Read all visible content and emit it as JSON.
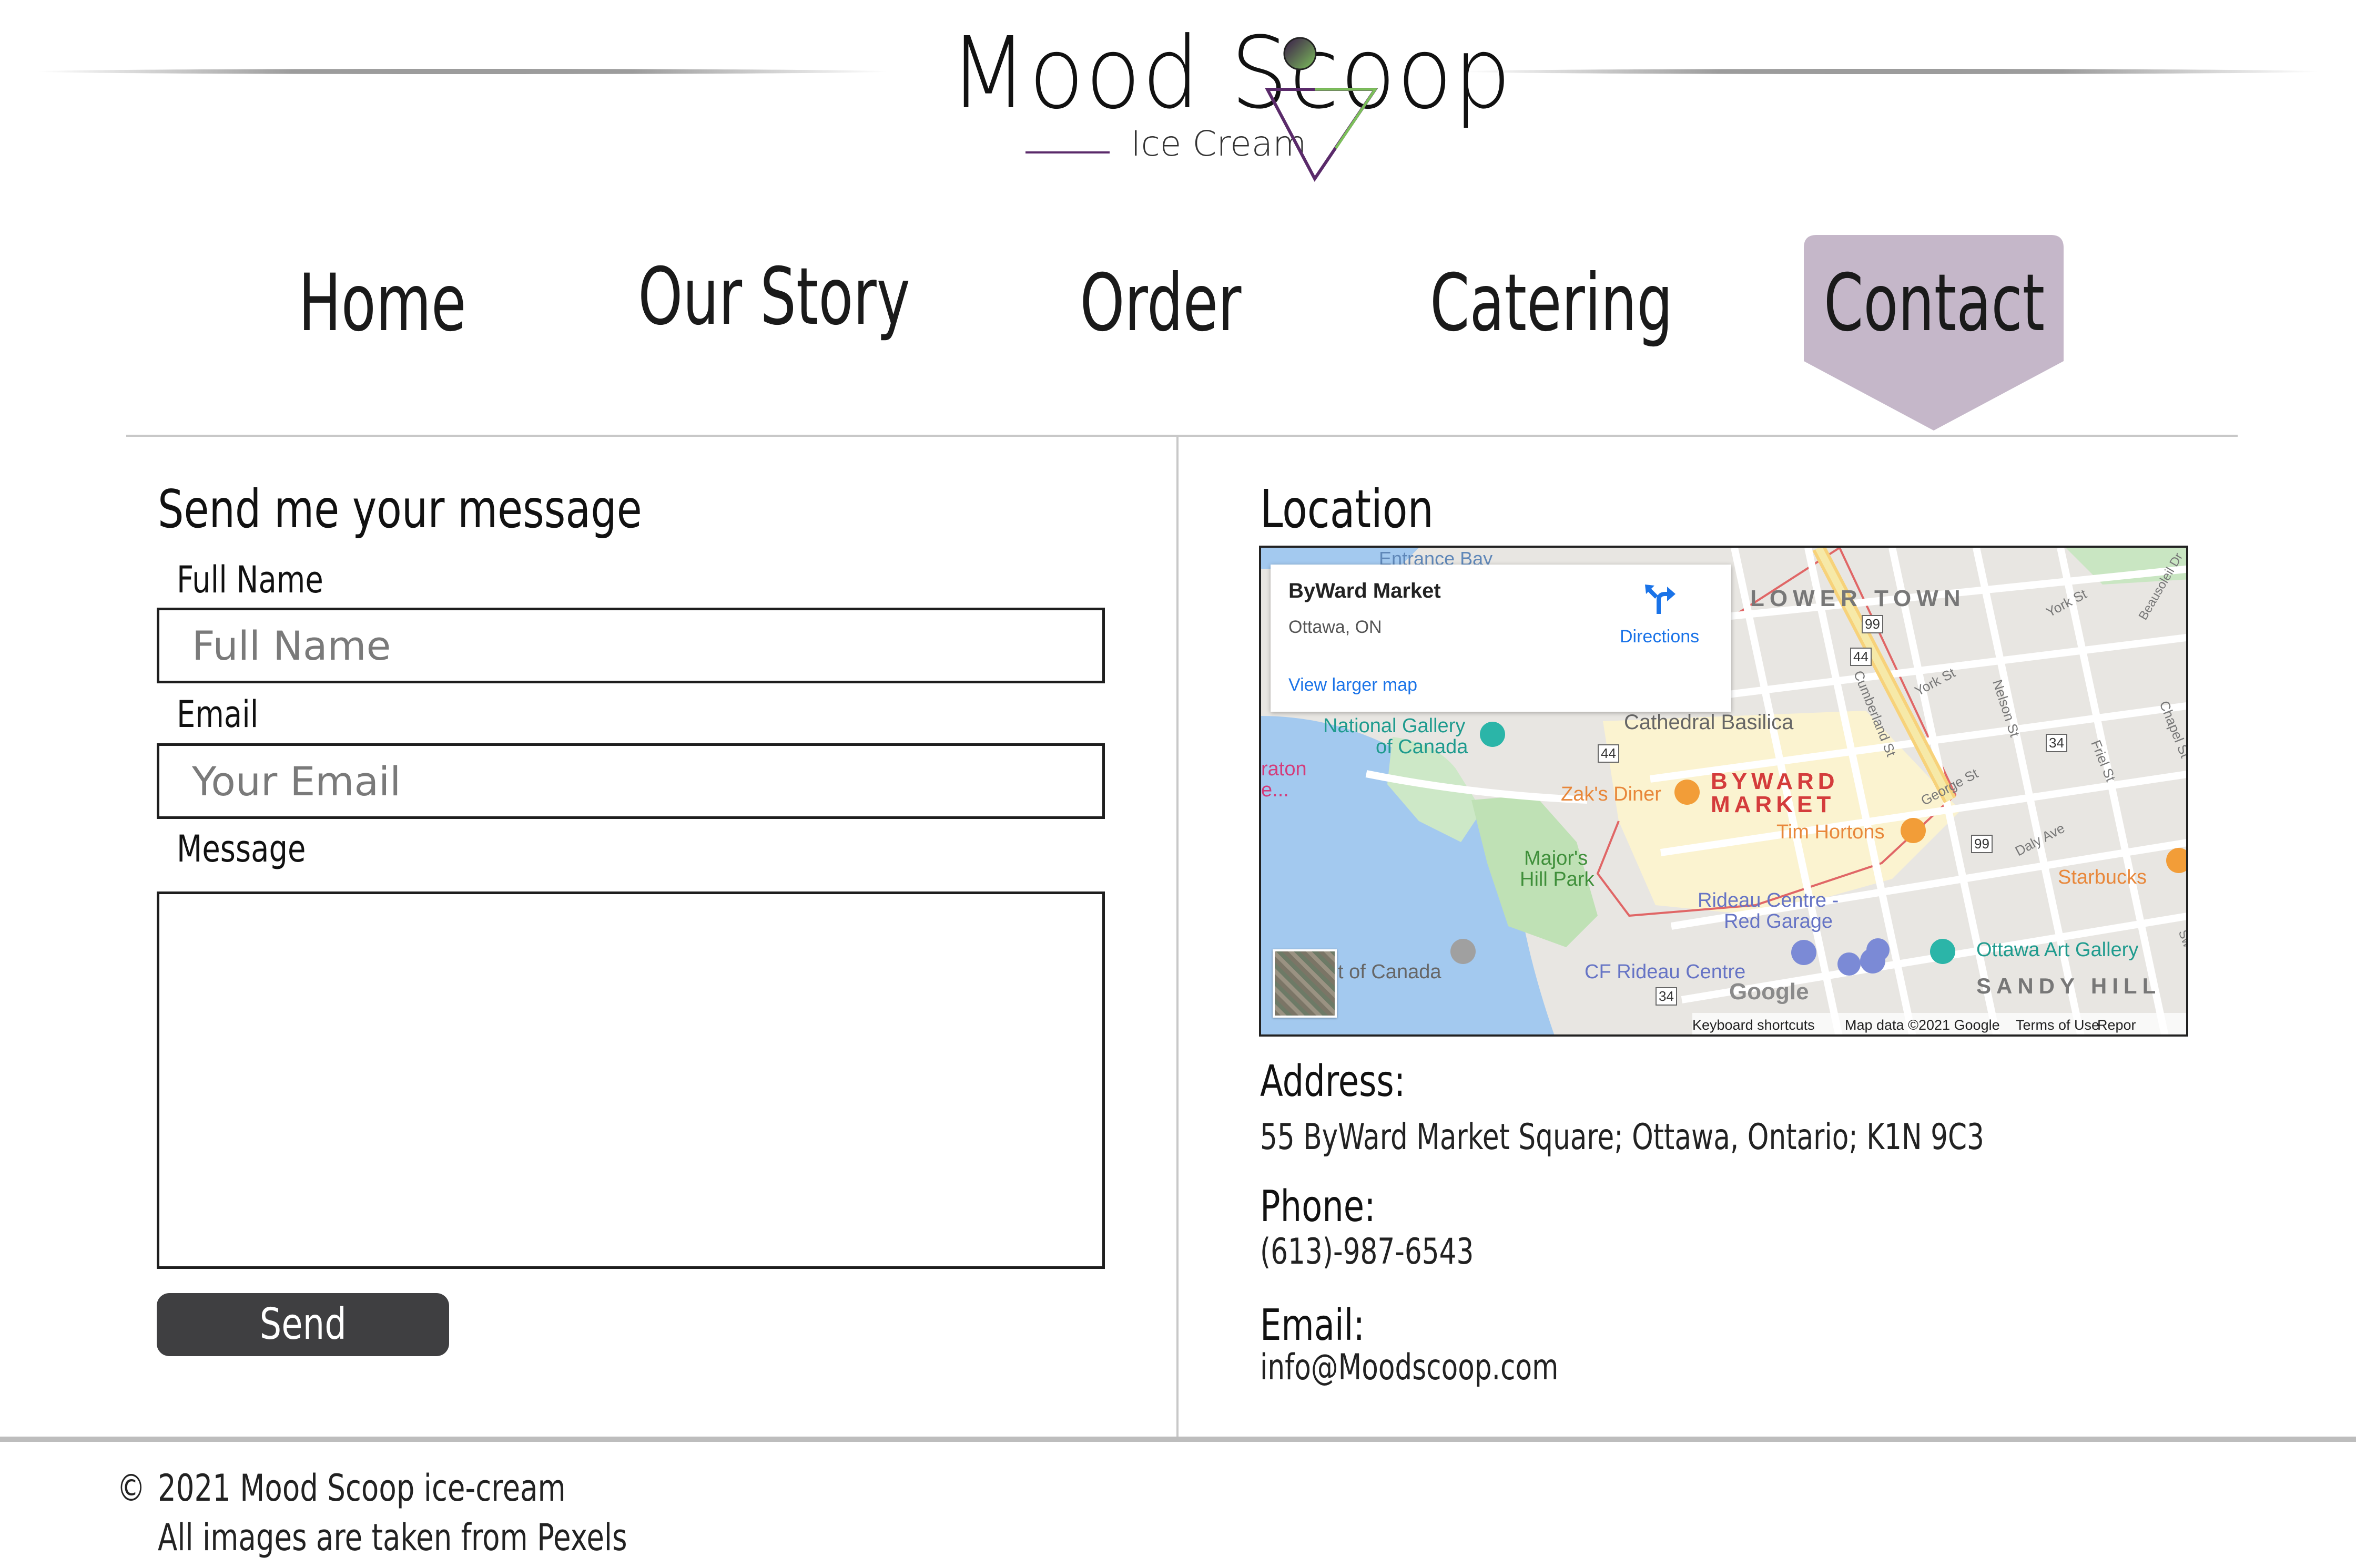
{
  "brand": {
    "name": "Mood Scoop",
    "tagline": "Ice Cream"
  },
  "nav": {
    "items": [
      {
        "label": "Home"
      },
      {
        "label": "Our Story"
      },
      {
        "label": "Order"
      },
      {
        "label": "Catering"
      },
      {
        "label": "Contact",
        "active": true
      }
    ],
    "active_color": "#c5b7c9"
  },
  "form": {
    "title": "Send me your message",
    "full_name": {
      "label": "Full Name",
      "placeholder": "Full Name",
      "value": ""
    },
    "email": {
      "label": "Email",
      "placeholder": "Your Email",
      "value": ""
    },
    "message": {
      "label": "Message",
      "value": ""
    },
    "send_label": "Send"
  },
  "location": {
    "title": "Location",
    "map": {
      "place": "ByWard Market",
      "city": "Ottawa, ON",
      "directions": "Directions",
      "larger_map": "View larger map",
      "labels": {
        "entrance_bay": "Entrance Bay",
        "lower_town": "LOWER TOWN",
        "national_gallery": "National Gallery",
        "of_canada": "of Canada",
        "cathedral": "Cathedral Basilica",
        "zaks": "Zak's Diner",
        "byward": "BYWARD",
        "market": "MARKET",
        "tim": "Tim Hortons",
        "majors": "Major's",
        "hill_park": "Hill Park",
        "rideau_centre": "Rideau Centre -",
        "red_garage": "Red Garage",
        "ottawa_art": "Ottawa Art Gallery",
        "starbucks": "Starbucks",
        "sandy_hill": "SANDY HILL",
        "cf_rideau": "CF Rideau Centre",
        "t_of_canada": "t of Canada",
        "sheraton": "raton",
        "sheraton2": "e...",
        "google": "Google",
        "york": "York St",
        "george": "George St",
        "nelson": "Nelson St",
        "cumberland": "Cumberland St",
        "daly": "Daly Ave",
        "friel": "Friel St",
        "chapel": "Chapel St",
        "beausoleil": "Beausoleil Dr",
        "york2": "York St",
        "sw": "Sw"
      },
      "route_badges": [
        "99",
        "44",
        "44",
        "34",
        "99",
        "34"
      ],
      "footer": {
        "shortcuts": "Keyboard shortcuts",
        "data": "Map data ©2021 Google",
        "terms": "Terms of Use",
        "report": "Repor"
      }
    },
    "address_label": "Address:",
    "address": "55 ByWard Market Square; Ottawa, Ontario; K1N 9C3",
    "phone_label": "Phone:",
    "phone": "(613)-987-6543",
    "email_label": "Email:",
    "email": "info@Moodscoop.com"
  },
  "footer": {
    "copyright_symbol": "©",
    "copyright": "2021 Mood Scoop ice-cream",
    "credit": "All images are taken from Pexels"
  }
}
